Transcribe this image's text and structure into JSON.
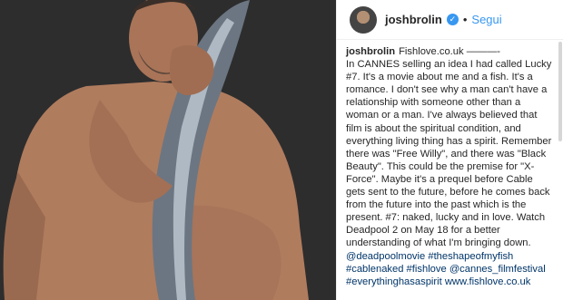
{
  "header": {
    "username": "joshbrolin",
    "verified_icon": "verified-icon",
    "separator": "•",
    "follow_label": "Segui"
  },
  "caption": {
    "username": "joshbrolin",
    "first_line": "Fishlove.co.uk ———-",
    "body": "In CANNES selling an idea I had called Lucky #7. It's a movie about me and a fish. It's a romance. I don't see why a man can't have a relationship with someone other than a woman or a man. I've always believed that film is about the spiritual condition, and everything living thing has a spirit. Remember there was \"Free Willy\", and there was \"Black Beauty\". This could be the premise for \"X-Force\". Maybe it's a prequel before Cable gets sent to the future, before he comes back from the future into the past which is the present. #7: naked, lucky and in love. Watch Deadpool 2 on May 18 for a better understanding of what I'm bringing down.",
    "tags": "@deadpoolmovie #theshapeofmyfish #cablenaked #fishlove @cannes_filmfestival #everythinghasaspirit www.fishlove.co.uk"
  },
  "colors": {
    "accent": "#3897f0",
    "text": "#262626",
    "photo_bg": "#2d2d2d"
  }
}
